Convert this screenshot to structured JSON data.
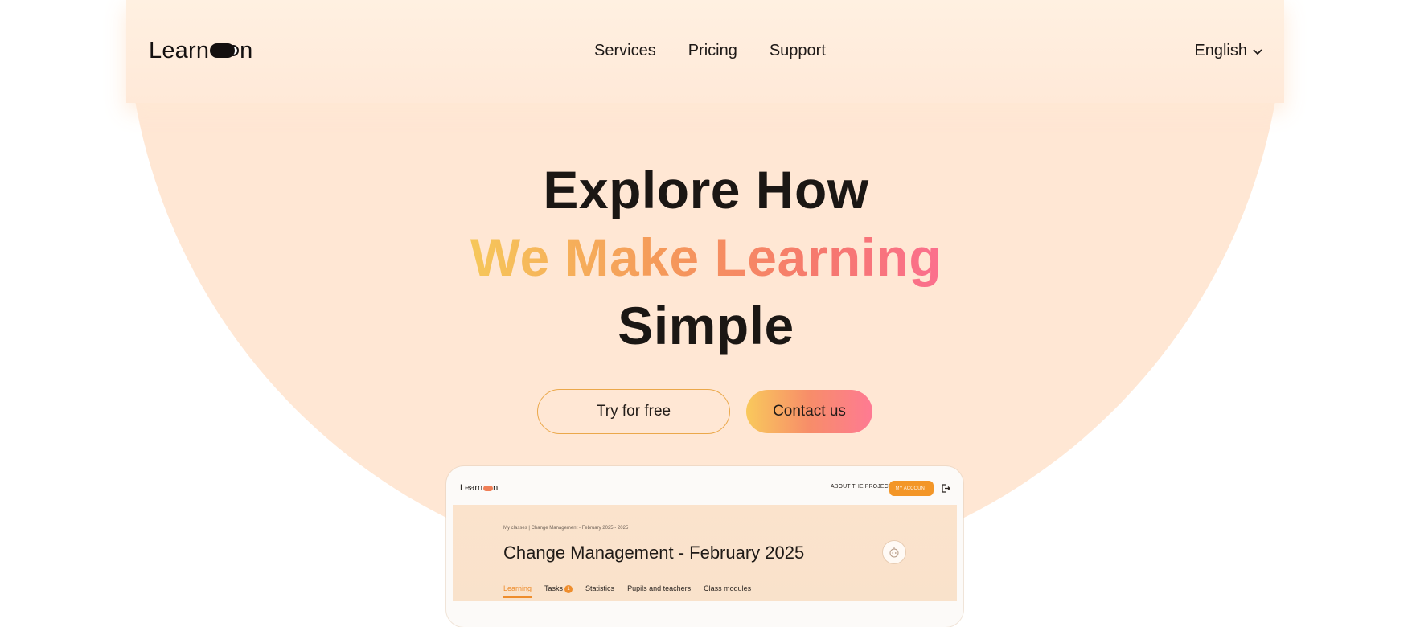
{
  "header": {
    "logo": {
      "text_before": "Learn",
      "text_after": "n"
    },
    "nav": [
      "Services",
      "Pricing",
      "Support"
    ],
    "language": "English"
  },
  "hero": {
    "line1": "Explore How",
    "line2": "We Make Learning",
    "line3": "Simple",
    "try_button": "Try for free",
    "contact_button": "Contact us"
  },
  "preview": {
    "logo_text": "Learn",
    "logo_tail": "n",
    "about": "ABOUT THE PROJECT",
    "account": "MY ACCOUNT",
    "breadcrumb": "My classes  |  Change Management - February 2025 - 2025",
    "title": "Change Management - February 2025",
    "tabs": [
      "Learning",
      "Tasks",
      "Statistics",
      "Pupils and teachers",
      "Class modules"
    ],
    "tasks_badge": "1"
  },
  "colors": {
    "background": "#ffe7d4",
    "accent_orange": "#f39628",
    "gradient_start": "#f6c75a",
    "gradient_end": "#fb6f8e",
    "text_dark": "#1b1714"
  }
}
